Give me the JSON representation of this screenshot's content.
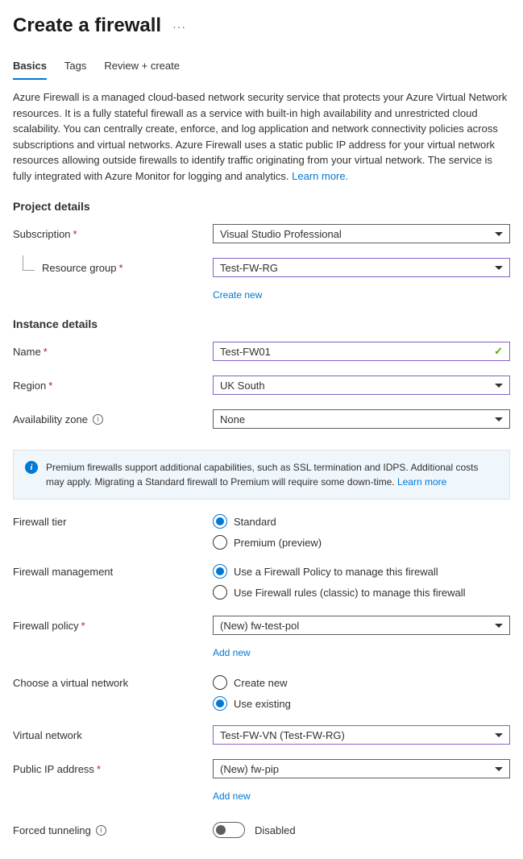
{
  "header": {
    "title": "Create a firewall",
    "ellipsis": "···"
  },
  "tabs": {
    "basics": "Basics",
    "tags": "Tags",
    "review": "Review + create"
  },
  "intro": {
    "text": "Azure Firewall is a managed cloud-based network security service that protects your Azure Virtual Network resources. It is a fully stateful firewall as a service with built-in high availability and unrestricted cloud scalability. You can centrally create, enforce, and log application and network connectivity policies across subscriptions and virtual networks. Azure Firewall uses a static public IP address for your virtual network resources allowing outside firewalls to identify traffic originating from your virtual network. The service is fully integrated with Azure Monitor for logging and analytics. ",
    "learn_more": "Learn more."
  },
  "sections": {
    "project": "Project details",
    "instance": "Instance details"
  },
  "labels": {
    "subscription": "Subscription",
    "resource_group": "Resource group",
    "name": "Name",
    "region": "Region",
    "avail_zone": "Availability zone",
    "firewall_tier": "Firewall tier",
    "firewall_mgmt": "Firewall management",
    "firewall_policy": "Firewall policy",
    "choose_vnet": "Choose a virtual network",
    "virtual_network": "Virtual network",
    "public_ip": "Public IP address",
    "forced_tunnel": "Forced tunneling"
  },
  "values": {
    "subscription": "Visual Studio Professional",
    "resource_group": "Test-FW-RG",
    "name": "Test-FW01",
    "region": "UK South",
    "avail_zone": "None",
    "tier_standard": "Standard",
    "tier_premium": "Premium (preview)",
    "mgmt_policy": "Use a Firewall Policy to manage this firewall",
    "mgmt_classic": "Use Firewall rules (classic) to manage this firewall",
    "firewall_policy": "(New) fw-test-pol",
    "vnet_create": "Create new",
    "vnet_existing": "Use existing",
    "virtual_network": "Test-FW-VN (Test-FW-RG)",
    "public_ip": "(New) fw-pip",
    "forced_tunnel": "Disabled"
  },
  "links": {
    "create_new": "Create new",
    "add_new": "Add new"
  },
  "banner": {
    "text": "Premium firewalls support additional capabilities, such as SSL termination and IDPS. Additional costs may apply. Migrating a Standard firewall to Premium will require some down-time. ",
    "learn_more": "Learn more"
  }
}
